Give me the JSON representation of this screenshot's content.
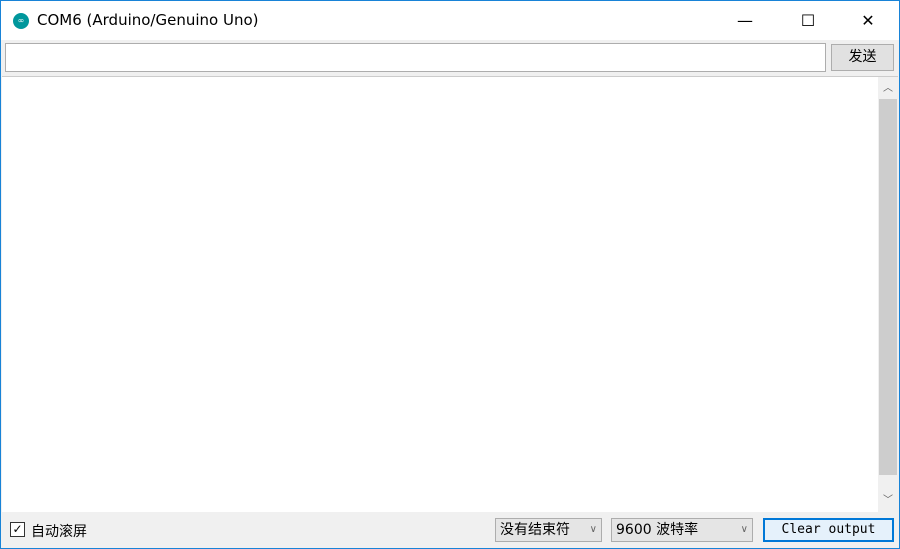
{
  "window": {
    "title": "COM6 (Arduino/Genuino Uno)",
    "minimize": "—",
    "maximize": "☐",
    "close": "✕"
  },
  "send": {
    "input_value": "",
    "button_label": "发送"
  },
  "output": {
    "text": ""
  },
  "footer": {
    "autoscroll_label": "自动滚屏",
    "autoscroll_checked": true,
    "line_ending": "没有结束符",
    "baud_rate": "9600 波特率",
    "clear_label": "Clear output"
  },
  "colors": {
    "accent": "#0078d7",
    "logo": "#00979c"
  }
}
